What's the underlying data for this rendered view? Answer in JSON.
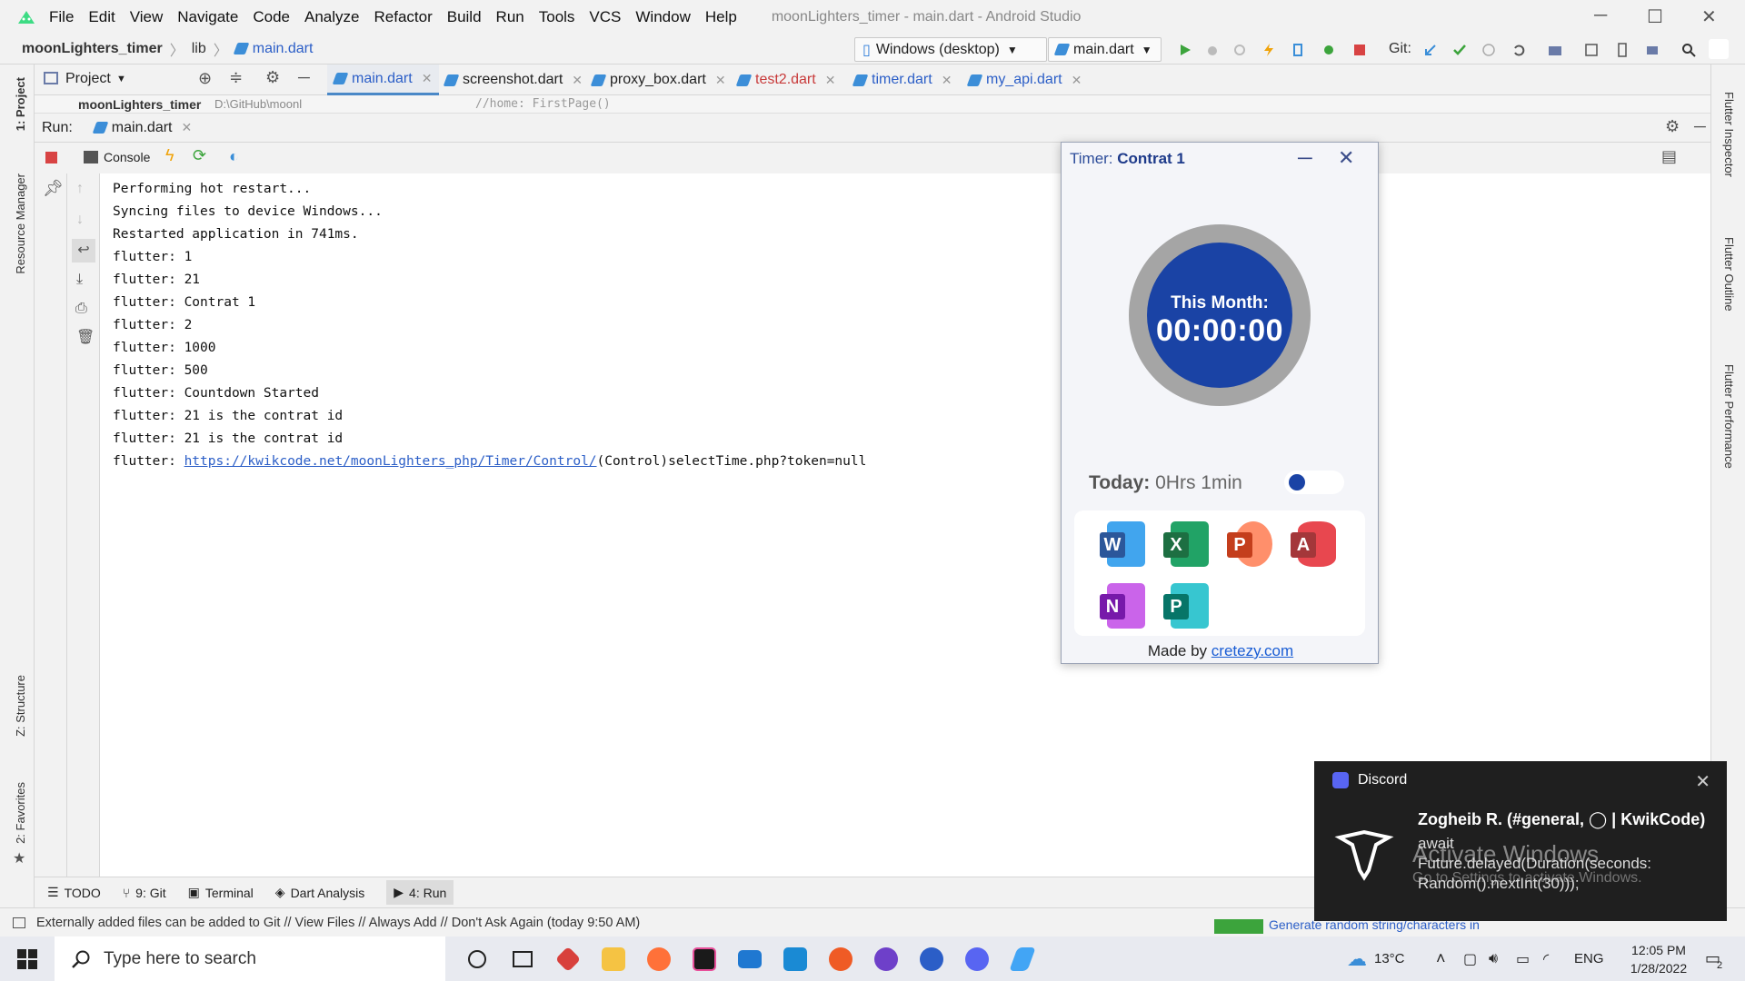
{
  "window": {
    "title": "moonLighters_timer - main.dart - Android Studio",
    "menu": [
      "File",
      "Edit",
      "View",
      "Navigate",
      "Code",
      "Analyze",
      "Refactor",
      "Build",
      "Run",
      "Tools",
      "VCS",
      "Window",
      "Help"
    ]
  },
  "breadcrumb": {
    "project": "moonLighters_timer",
    "folder": "lib",
    "file": "main.dart"
  },
  "toolbar": {
    "device": "Windows (desktop)",
    "config": "main.dart",
    "git_label": "Git:"
  },
  "project_panel": {
    "label": "Project",
    "root": "moonLighters_timer",
    "path": "D:\\GitHub\\moonl"
  },
  "editor_tabs": [
    {
      "label": "main.dart",
      "active": true
    },
    {
      "label": "screenshot.dart"
    },
    {
      "label": "proxy_box.dart"
    },
    {
      "label": "test2.dart",
      "error": true
    },
    {
      "label": "timer.dart"
    },
    {
      "label": "my_api.dart"
    }
  ],
  "editor_peek": "//home: FirstPage()",
  "run_panel": {
    "label": "Run:",
    "tab": "main.dart",
    "console_tab": "Console"
  },
  "console": {
    "lines": [
      "Performing hot restart...",
      "Syncing files to device Windows...",
      "Restarted application in 741ms.",
      "flutter: 1",
      "flutter: 21",
      "flutter: Contrat 1",
      "flutter: 2",
      "flutter: 1000",
      "flutter: 500",
      "flutter: Countdown Started",
      "flutter: 21 is the contrat id",
      "flutter: 21 is the contrat id"
    ],
    "url_prefix": "flutter: ",
    "url": "https://kwikcode.net/moonLighters_php/Timer/Control/",
    "url_suffix": "(Control)selectTime.php?token=null"
  },
  "left_tabs": [
    "1: Project",
    "Resource Manager",
    "Z: Structure",
    "2: Favorites"
  ],
  "right_tabs": [
    "Flutter Inspector",
    "Flutter Outline",
    "Flutter Performance"
  ],
  "bottom_tabs": [
    {
      "label": "TODO"
    },
    {
      "label": "9: Git"
    },
    {
      "label": "Terminal"
    },
    {
      "label": "Dart Analysis"
    },
    {
      "label": "4: Run",
      "active": true
    }
  ],
  "status": {
    "message": "Externally added files can be added to Git // View Files // Always Add // Don't Ask Again (today 9:50 AM)",
    "hint": "Generate random string/characters in"
  },
  "timer_app": {
    "title_prefix": "Timer: ",
    "title_name": "Contrat 1",
    "ring_label": "This Month:",
    "ring_value": "00:00:00",
    "today_label": "Today:",
    "today_value": " 0Hrs 1min",
    "toggle_on": false,
    "apps": [
      {
        "icon": "word-icon",
        "letter": "W",
        "color": "#2b579a",
        "back": "#41a5ee"
      },
      {
        "icon": "excel-icon",
        "letter": "X",
        "color": "#1d6f42",
        "back": "#21a366"
      },
      {
        "icon": "powerpoint-icon",
        "letter": "P",
        "color": "#c43e1c",
        "back": "#ff8f6b"
      },
      {
        "icon": "access-icon",
        "letter": "A",
        "color": "#a4373a",
        "back": "#e8474f"
      },
      {
        "icon": "onenote-icon",
        "letter": "N",
        "color": "#7719aa",
        "back": "#ca64ea"
      },
      {
        "icon": "publisher-icon",
        "letter": "P",
        "color": "#077568",
        "back": "#37c6d0"
      }
    ],
    "made_by_prefix": "Made by ",
    "made_by_link": "cretezy.com",
    "colors": {
      "accent": "#1a43a5",
      "ring": "#a5a5a5"
    }
  },
  "toast": {
    "app": "Discord",
    "sender": "Zogheib R. (#general, ◯ | KwikCode)",
    "body_line1": "await",
    "body_line2": "Future.delayed(Duration(seconds:",
    "body_line3": "Random().nextInt(30)));"
  },
  "activation": {
    "title": "Activate Windows",
    "subtitle": "Go to Settings to activate Windows."
  },
  "taskbar": {
    "search_placeholder": "Type here to search",
    "weather": "13°C",
    "lang": "ENG",
    "time": "12:05 PM",
    "date": "1/28/2022",
    "notif_count": "2"
  }
}
